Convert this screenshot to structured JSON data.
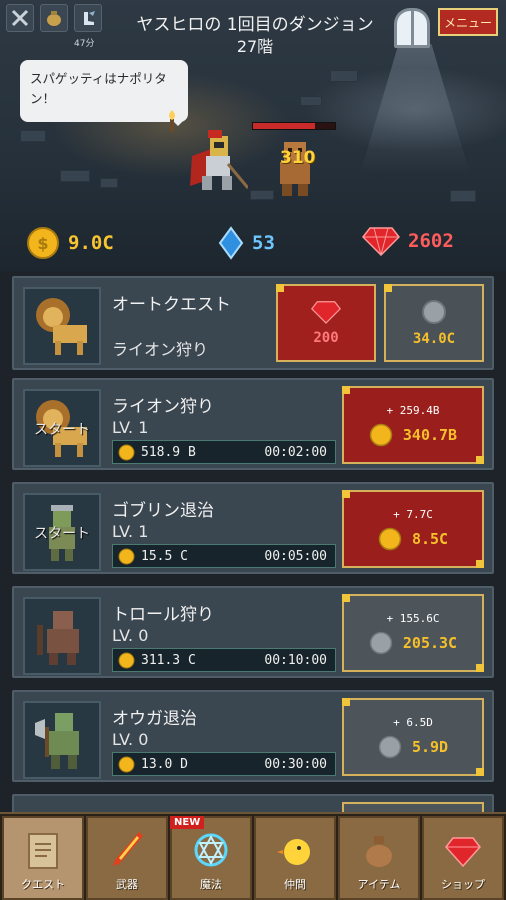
{
  "header": {
    "dungeon_title": "ヤスヒロの 1回目のダンジョン",
    "dungeon_floor": "27階",
    "timer": "47分",
    "menu_label": "メニュー",
    "icons": [
      "crossed-swords-icon",
      "money-bag-icon",
      "winged-boot-icon"
    ]
  },
  "battle": {
    "speech": "スパゲッティはナポリタン！",
    "damage": "310",
    "enemy_hp_fraction": 0.75
  },
  "currency": {
    "gold": "9.0C",
    "crystal": "53",
    "ruby": "2602"
  },
  "auto_quest": {
    "title": "オートクエスト",
    "subtitle": "ライオン狩り",
    "ruby_cost": "200",
    "gold_cost": "34.0C"
  },
  "quests": [
    {
      "name": "ライオン狩り",
      "level": "LV. 1",
      "reward": "518.9  B",
      "time": "00:02:00",
      "start_label": "スタート",
      "upgrade_plus": "+ 259.4B",
      "upgrade_cost": "340.7B",
      "box_color": "red"
    },
    {
      "name": "ゴブリン退治",
      "level": "LV. 1",
      "reward": "15.5  C",
      "time": "00:05:00",
      "start_label": "スタート",
      "upgrade_plus": "+ 7.7C",
      "upgrade_cost": "8.5C",
      "box_color": "red"
    },
    {
      "name": "トロール狩り",
      "level": "LV. 0",
      "reward": "311.3  C",
      "time": "00:10:00",
      "start_label": "",
      "upgrade_plus": "+ 155.6C",
      "upgrade_cost": "205.3C",
      "box_color": "grey"
    },
    {
      "name": "オウガ退治",
      "level": "LV. 0",
      "reward": "13.0  D",
      "time": "00:30:00",
      "start_label": "",
      "upgrade_plus": "+ 6.5D",
      "upgrade_cost": "5.9D",
      "box_color": "grey"
    }
  ],
  "nav": {
    "items": [
      {
        "label": "クエスト",
        "icon": "scroll-icon"
      },
      {
        "label": "武器",
        "icon": "flame-sword-icon"
      },
      {
        "label": "魔法",
        "icon": "magic-circle-icon",
        "badge": "NEW"
      },
      {
        "label": "仲間",
        "icon": "chick-icon"
      },
      {
        "label": "アイテム",
        "icon": "item-bag-icon"
      },
      {
        "label": "ショップ",
        "icon": "ruby-icon"
      }
    ]
  },
  "colors": {
    "gold": "#f7c531",
    "crystal": "#6fc6ff",
    "ruby": "#ff5c5c",
    "red_box": "#9a1f1c",
    "grey_box": "#4d545a",
    "menu_red": "#b32a22"
  }
}
